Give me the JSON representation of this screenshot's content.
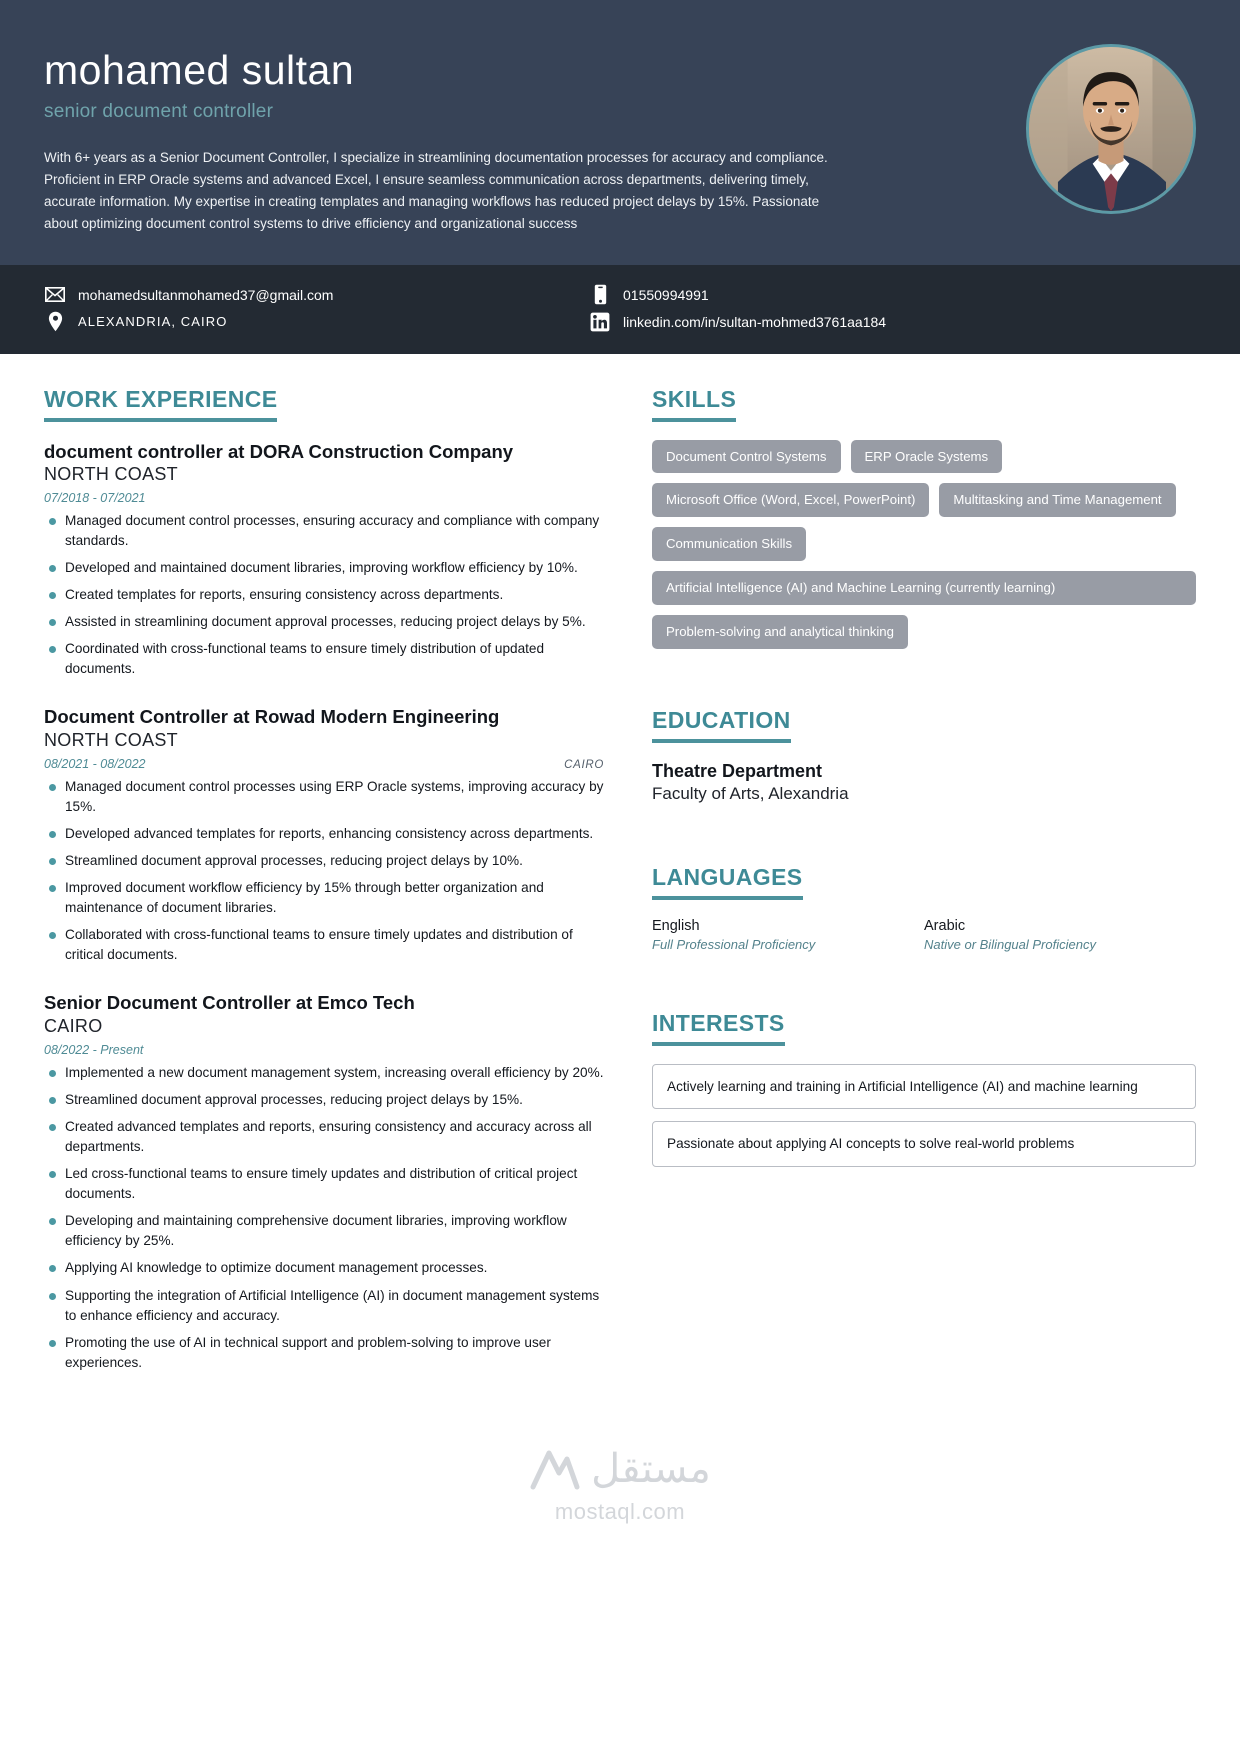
{
  "header": {
    "name": "mohamed sultan",
    "job_title": "senior document controller",
    "summary": "With 6+ years as a Senior Document Controller, I specialize in streamlining documentation processes for accuracy and compliance. Proficient in ERP Oracle systems and advanced Excel, I ensure seamless communication across departments, delivering timely, accurate information. My expertise in creating templates and managing workflows has reduced project delays by 15%. Passionate about optimizing document control systems to drive efficiency and organizational success",
    "accent_color": "#4c929c",
    "background_color": "#374357",
    "photo_alt": "portrait-photo"
  },
  "contact": {
    "email": "mohamedsultanmohamed37@gmail.com",
    "phone": "01550994991",
    "location": "ALEXANDRIA, CAIRO",
    "linkedin": "linkedin.com/in/sultan-mohmed3761aa184"
  },
  "sections": {
    "work_experience_title": "WORK EXPERIENCE",
    "skills_title": "SKILLS",
    "education_title": "EDUCATION",
    "languages_title": "LANGUAGES",
    "interests_title": "INTERESTS"
  },
  "jobs": [
    {
      "title": "document controller at DORA Construction Company",
      "company": "NORTH COAST",
      "date": "07/2018 - 07/2021",
      "location": "",
      "bullets": [
        "Managed document control processes, ensuring accuracy and compliance with company standards.",
        "Developed and maintained document libraries, improving workflow efficiency by 10%.",
        "Created templates for reports, ensuring consistency across departments.",
        "Assisted in streamlining document approval processes, reducing project delays by 5%.",
        "Coordinated with cross-functional teams to ensure timely distribution of updated documents."
      ]
    },
    {
      "title": "Document Controller at Rowad Modern Engineering",
      "company": "NORTH COAST",
      "date": "08/2021 - 08/2022",
      "location": "CAIRO",
      "bullets": [
        "Managed document control processes using ERP Oracle systems, improving accuracy by 15%.",
        "Developed advanced templates for reports, enhancing consistency across departments.",
        "Streamlined document approval processes, reducing project delays by 10%.",
        "Improved document workflow efficiency by 15% through better organization and maintenance of document libraries.",
        "Collaborated with cross-functional teams to ensure timely updates and distribution of critical documents."
      ]
    },
    {
      "title": "Senior Document Controller at Emco Tech",
      "company": "CAIRO",
      "date": "08/2022 - Present",
      "location": "",
      "bullets": [
        "Implemented a new document management system, increasing overall efficiency by 20%.",
        "Streamlined document approval processes, reducing project delays by 15%.",
        "Created advanced templates and reports, ensuring consistency and accuracy across all departments.",
        "Led cross-functional teams to ensure timely updates and distribution of critical project documents.",
        "Developing and maintaining comprehensive document libraries, improving workflow efficiency by 25%.",
        "Applying AI knowledge to optimize document management processes.",
        "Supporting the integration of Artificial Intelligence (AI) in document management systems to enhance efficiency and accuracy.",
        "Promoting the use of AI in technical support and problem-solving to improve user experiences."
      ]
    }
  ],
  "skills": [
    {
      "label": "Document Control Systems",
      "full_width": false
    },
    {
      "label": "ERP Oracle Systems",
      "full_width": false
    },
    {
      "label": "Microsoft Office (Word, Excel, PowerPoint)",
      "full_width": false
    },
    {
      "label": "Multitasking and Time Management",
      "full_width": false
    },
    {
      "label": "Communication Skills",
      "full_width": false
    },
    {
      "label": "Artificial Intelligence (AI) and Machine Learning (currently learning)",
      "full_width": true
    },
    {
      "label": "Problem-solving and analytical thinking",
      "full_width": false
    }
  ],
  "education": {
    "degree": "Theatre Department",
    "school": "Faculty of Arts, Alexandria"
  },
  "languages": [
    {
      "name": "English",
      "level": "Full Professional Proficiency"
    },
    {
      "name": "Arabic",
      "level": "Native or Bilingual Proficiency"
    }
  ],
  "interests": [
    "Actively learning and training in Artificial Intelligence (AI) and machine learning",
    "Passionate about applying AI concepts to solve real-world problems"
  ],
  "footer": {
    "watermark_ar": "مستقل",
    "watermark_latin": "mostaql.com"
  }
}
